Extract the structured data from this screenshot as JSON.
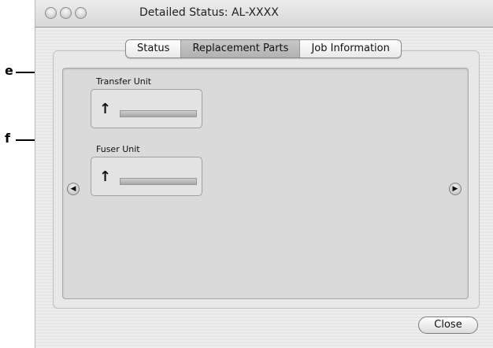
{
  "window": {
    "title": "Detailed Status: AL-XXXX"
  },
  "tabs": [
    {
      "label": "Status",
      "active": false
    },
    {
      "label": "Replacement Parts",
      "active": true
    },
    {
      "label": "Job Information",
      "active": false
    }
  ],
  "parts": [
    {
      "label": "Transfer Unit",
      "icon": "wrench-icon",
      "callout": "e"
    },
    {
      "label": "Fuser Unit",
      "icon": "wrench-icon",
      "callout": "f"
    }
  ],
  "buttons": {
    "close_label": "Close",
    "prev_glyph": "◀",
    "next_glyph": "▶"
  },
  "icons": {
    "wrench_glyph": "↑"
  }
}
